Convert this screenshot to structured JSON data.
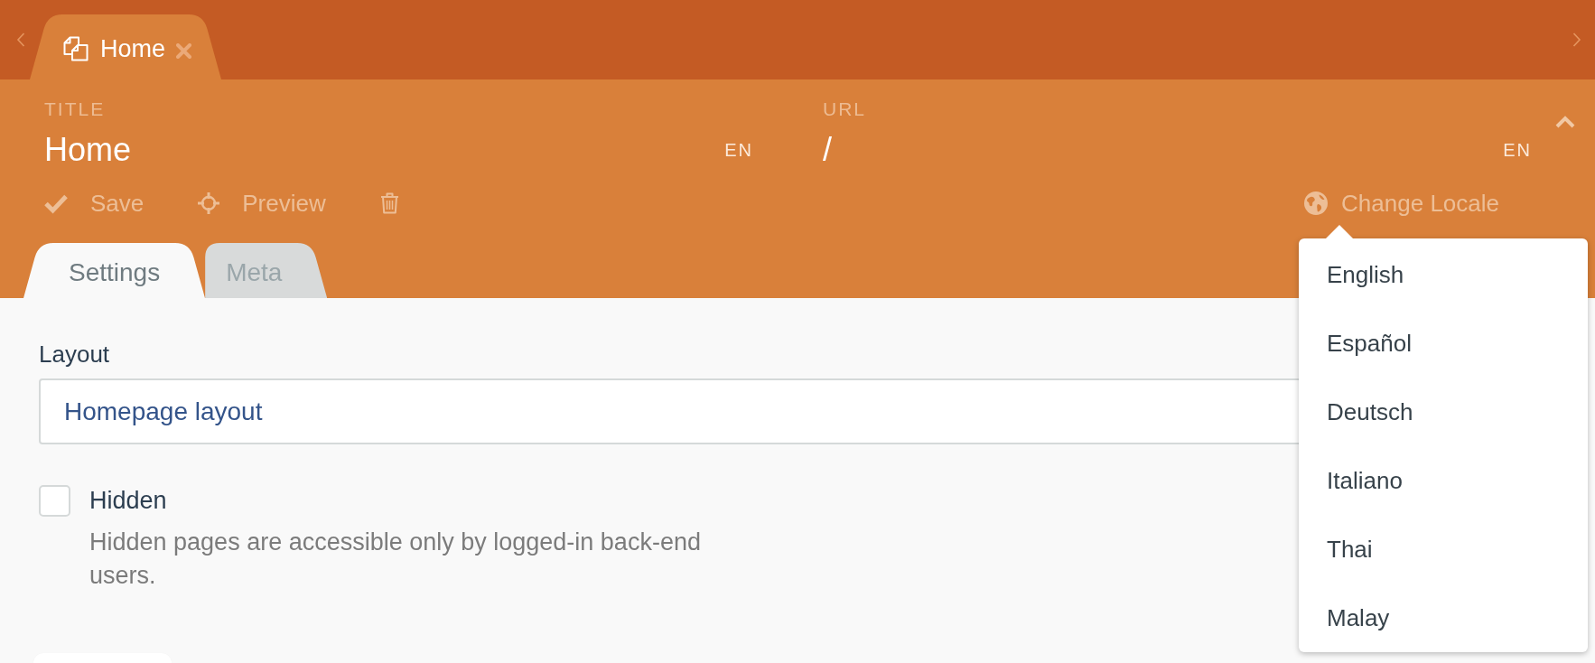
{
  "tab_bar": {
    "tabs": [
      {
        "label": "Home",
        "selected": true
      }
    ]
  },
  "header": {
    "expanded": true,
    "fields": [
      {
        "label": "TITLE",
        "value": "Home",
        "locale": "EN"
      },
      {
        "label": "URL",
        "value": "/",
        "locale": "EN"
      }
    ],
    "toolbar": [
      {
        "kind": "save",
        "label": "Save"
      },
      {
        "kind": "preview",
        "label": "Preview"
      },
      {
        "kind": "delete"
      }
    ],
    "change_locale": {
      "label": "Change Locale"
    }
  },
  "locale_menu": {
    "items": [
      {
        "label": "English",
        "selected": false
      },
      {
        "label": "Español",
        "selected": false
      },
      {
        "label": "Deutsch",
        "selected": false
      },
      {
        "label": "Italiano",
        "selected": false
      },
      {
        "label": "Thai",
        "selected": false
      },
      {
        "label": "Malay",
        "selected": false
      }
    ]
  },
  "form_tabs": [
    {
      "label": "Settings",
      "selected": true
    },
    {
      "label": "Meta",
      "selected": false
    }
  ],
  "form": {
    "layout": {
      "label": "Layout",
      "value": "Homepage layout"
    },
    "hidden": {
      "label": "Hidden",
      "checked": false,
      "help": "Hidden pages are accessible only by logged-in back-end users."
    }
  }
}
